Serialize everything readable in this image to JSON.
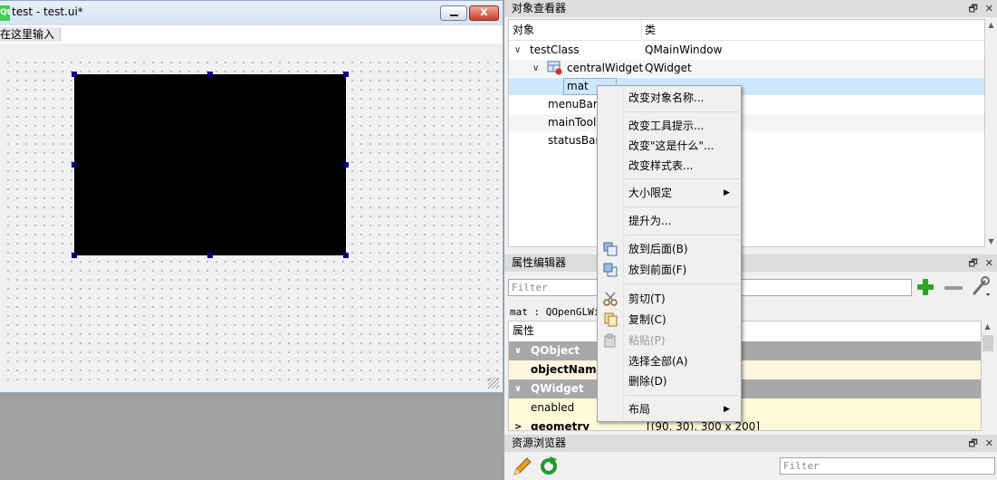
{
  "subwindow": {
    "logo": "Qt",
    "title": "test - test.ui*",
    "close_glyph": "x",
    "menu_placeholder": "在这里输入"
  },
  "object_inspector": {
    "title": "对象查看器",
    "col_object": "对象",
    "col_class": "类",
    "rows": [
      {
        "name": "testClass",
        "class": "QMainWindow"
      },
      {
        "name": "centralWidget",
        "class": "QWidget"
      },
      {
        "name": "mat",
        "class": ""
      },
      {
        "name": "menuBar",
        "class": ""
      },
      {
        "name": "mainTool",
        "class": ""
      },
      {
        "name": "statusBar",
        "class": ""
      }
    ]
  },
  "property_editor": {
    "title": "属性编辑器",
    "filter_placeholder": "Filter",
    "object_info": "mat : QOpenGLWid",
    "header": "属性",
    "rows": [
      {
        "kind": "group",
        "name": "QObject",
        "value": ""
      },
      {
        "kind": "prop",
        "name": "objectName",
        "value": ""
      },
      {
        "kind": "group",
        "name": "QWidget",
        "value": ""
      },
      {
        "kind": "prop",
        "name": "enabled",
        "value": ""
      },
      {
        "kind": "prop",
        "name": "geometry",
        "value": "[(90, 30), 300 x 200]"
      }
    ]
  },
  "resource_browser": {
    "title": "资源浏览器",
    "filter_placeholder": "Filter"
  },
  "dock_icons": {
    "float": "🗗",
    "close": "✕"
  },
  "context_menu": {
    "items": [
      {
        "label": "改变对象名称...",
        "type": "item"
      },
      {
        "label": "改变工具提示...",
        "type": "item"
      },
      {
        "label": "改变\"这是什么\"...",
        "type": "item"
      },
      {
        "label": "改变样式表...",
        "type": "item"
      },
      {
        "label": "大小限定",
        "type": "submenu"
      },
      {
        "label": "提升为...",
        "type": "item"
      },
      {
        "label": "放到后面(B)",
        "type": "item"
      },
      {
        "label": "放到前面(F)",
        "type": "item"
      },
      {
        "label": "剪切(T)",
        "type": "item"
      },
      {
        "label": "复制(C)",
        "type": "item"
      },
      {
        "label": "粘贴(P)",
        "type": "disabled"
      },
      {
        "label": "选择全部(A)",
        "type": "item"
      },
      {
        "label": "删除(D)",
        "type": "item"
      },
      {
        "label": "布局",
        "type": "submenu"
      }
    ],
    "submenu_arrow": "▶"
  },
  "tree_arrows": {
    "expanded": "∨",
    "collapsed": ">"
  },
  "scroll_arrows": {
    "up": "▲",
    "down": "▼"
  }
}
